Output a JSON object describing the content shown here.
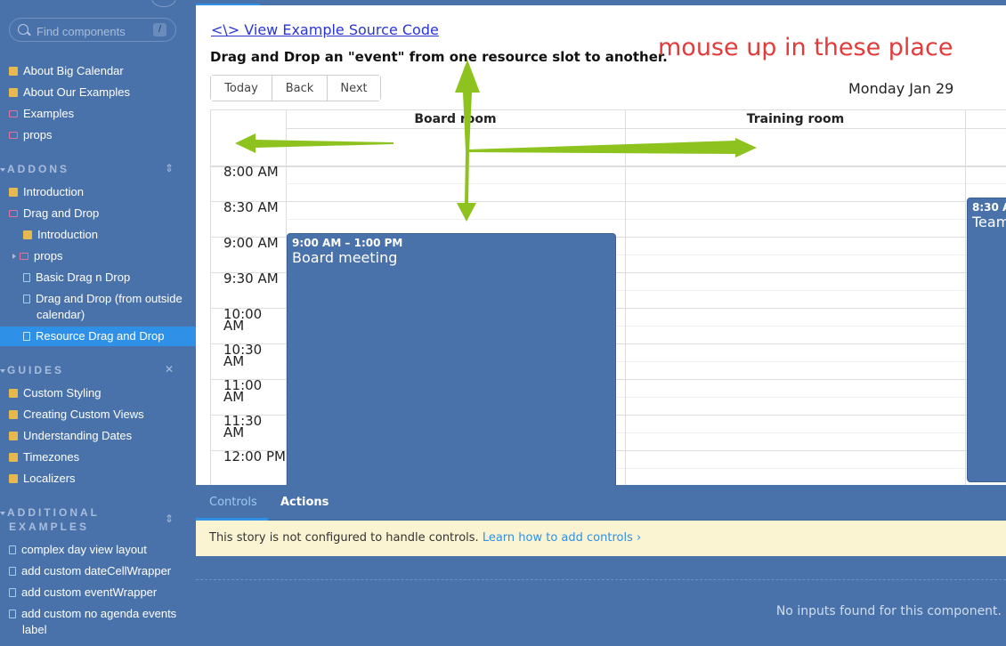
{
  "sidebar": {
    "search": {
      "placeholder": "Find components",
      "shortcut": "/"
    },
    "top_items": [
      {
        "label": "About Big Calendar",
        "icon": "doc-icon"
      },
      {
        "label": "About Our Examples",
        "icon": "doc-icon"
      },
      {
        "label": "Examples",
        "icon": "folder-icon"
      },
      {
        "label": "props",
        "icon": "folder-icon"
      }
    ],
    "addons": {
      "title": "ADDONS",
      "items": [
        {
          "label": "Introduction"
        },
        {
          "label": "Drag and Drop"
        },
        {
          "label": "Introduction"
        },
        {
          "label": "props"
        },
        {
          "label": "Basic Drag n Drop"
        },
        {
          "label": "Drag and Drop (from outside"
        },
        {
          "label": "calendar)"
        },
        {
          "label": "Resource Drag and Drop"
        }
      ]
    },
    "guides": {
      "title": "GUIDES",
      "items": [
        {
          "label": "Custom Styling"
        },
        {
          "label": "Creating Custom Views"
        },
        {
          "label": "Understanding Dates"
        },
        {
          "label": "Timezones"
        },
        {
          "label": "Localizers"
        }
      ]
    },
    "additional": {
      "title_line1": "ADDITIONAL",
      "title_line2": "EXAMPLES",
      "items": [
        {
          "label": "complex day view layout"
        },
        {
          "label": "add custom dateCellWrapper"
        },
        {
          "label": "add custom eventWrapper"
        },
        {
          "label": "add custom no agenda events"
        },
        {
          "label": "label"
        }
      ]
    }
  },
  "main": {
    "source_link": "<\\> View Example Source Code",
    "heading": "Drag and Drop an \"event\" from one resource slot to another.",
    "annotation": "mouse up in these place",
    "toolbar": {
      "today": "Today",
      "back": "Back",
      "next": "Next"
    },
    "date_label": "Monday Jan 29",
    "resources": [
      "Board room",
      "Training room"
    ],
    "times": [
      "8:00 AM",
      "8:30 AM",
      "9:00 AM",
      "9:30 AM",
      "10:00 AM",
      "10:30 AM",
      "11:00 AM",
      "11:30 AM",
      "12:00 PM"
    ],
    "events": [
      {
        "time": "9:00 AM – 1:00 PM",
        "title": "Board meeting"
      },
      {
        "time": "8:30 A",
        "title": "Team"
      }
    ],
    "arrow_color": "#8dc21f",
    "event_color": "#4a72aa"
  },
  "panel": {
    "tabs": {
      "controls": "Controls",
      "actions": "Actions"
    },
    "notice_text": "This story is not configured to handle controls.",
    "notice_link": "Learn how to add controls ›",
    "no_inputs": "No inputs found for this component."
  }
}
